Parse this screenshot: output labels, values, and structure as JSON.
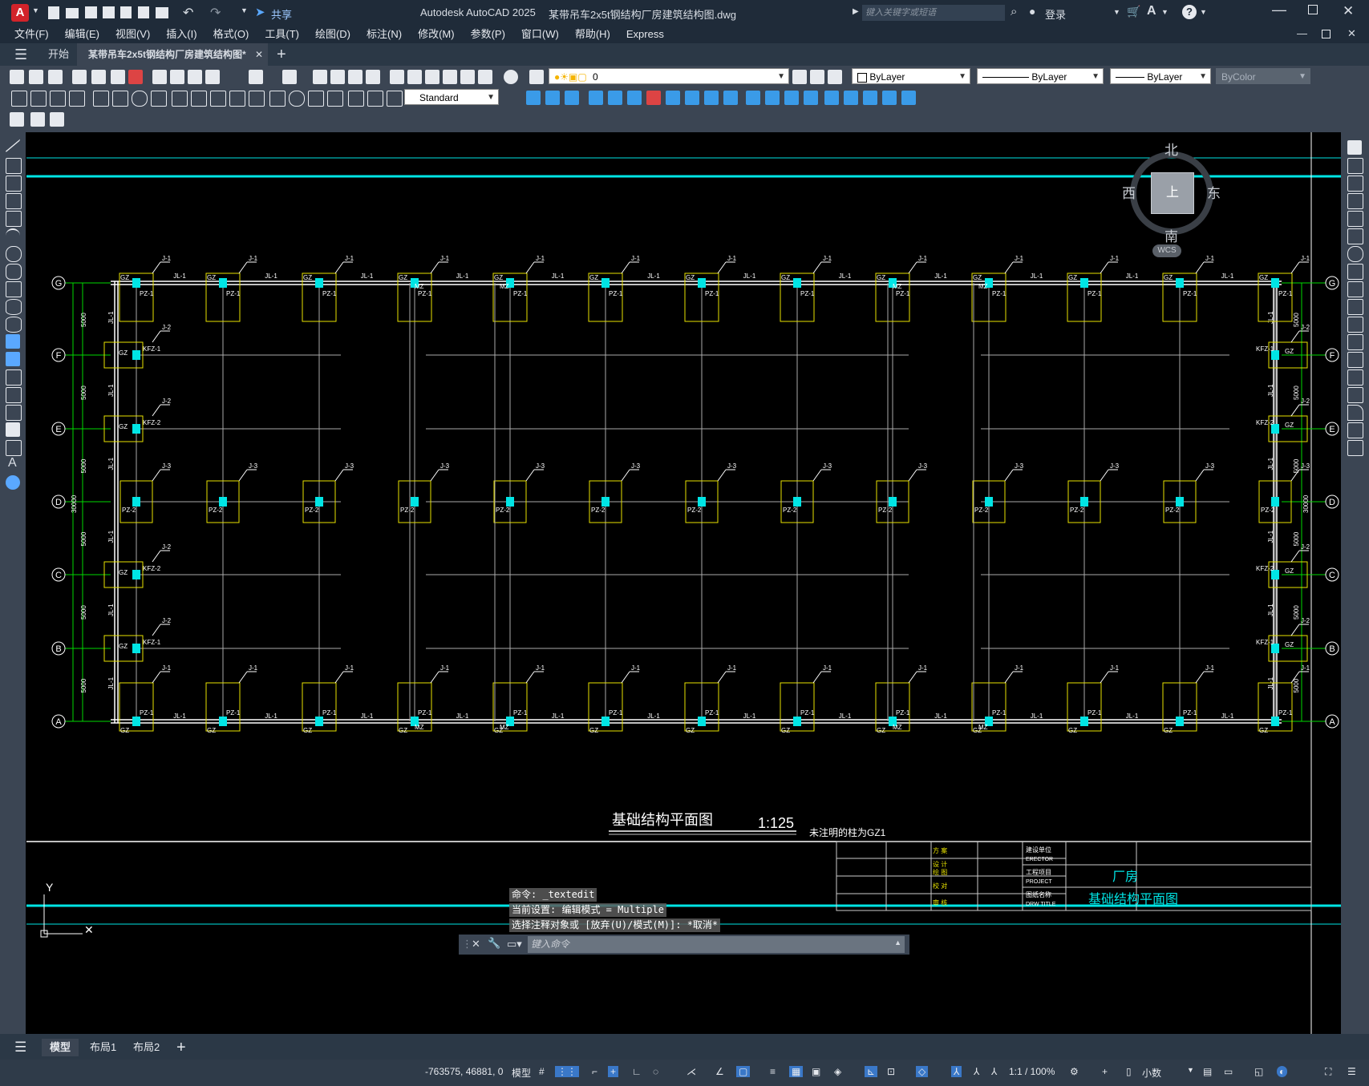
{
  "app": {
    "title": "Autodesk AutoCAD 2025",
    "filename": "某带吊车2x5t钢结构厂房建筑结构图.dwg",
    "search_placeholder": "键入关键字或短语",
    "login": "登录",
    "share": "共享"
  },
  "menu": [
    "文件(F)",
    "编辑(E)",
    "视图(V)",
    "插入(I)",
    "格式(O)",
    "工具(T)",
    "绘图(D)",
    "标注(N)",
    "修改(M)",
    "参数(P)",
    "窗口(W)",
    "帮助(H)",
    "Express"
  ],
  "tabs": {
    "start": "开始",
    "active": "某带吊车2x5t钢结构厂房建筑结构图*"
  },
  "toolbar": {
    "layer_value": "0",
    "color_value": "ByLayer",
    "linetype_value": "ByLayer",
    "lineweight_value": "ByLayer",
    "plotstyle_value": "ByColor",
    "dimstyle_value": "Standard"
  },
  "viewcube": {
    "north": "北",
    "south": "南",
    "east": "东",
    "west": "西",
    "top": "上",
    "wcs": "WCS"
  },
  "drawing": {
    "title": "基础结构平面图",
    "scale": "1:125",
    "note": "未注明的柱为GZ1",
    "axes_rows": [
      "G",
      "F",
      "E",
      "D",
      "C",
      "B",
      "A"
    ],
    "dim_5000": "5000",
    "dim_30000": "30000",
    "labels": {
      "J1": "J-1",
      "J2": "J-2",
      "J3": "J-3",
      "JL1": "JL-1",
      "GZ": "GZ",
      "MZ": "MZ",
      "PZ1": "PZ-1",
      "PZ2": "PZ-2",
      "KFZ1": "KFZ-1",
      "KFZ2": "KFZ-2"
    },
    "title_block": {
      "erector_cn": "建设单位",
      "erector_en": "ERECTOR",
      "project_cn": "工程项目",
      "project_en": "PROJECT",
      "drw_cn": "图纸名称",
      "drw_en": "DRW TITLE",
      "project_value": "厂房",
      "drw_value": "基础结构平面图",
      "fang_an": "方 案",
      "she_ji": "设 计",
      "hui_tu": "绘 图",
      "jiao_dui": "校 对",
      "shen_he": "审 核"
    },
    "ucs_y": "Y"
  },
  "command": {
    "line1": "命令: _textedit",
    "line2": "当前设置: 编辑模式 = Multiple",
    "line3": "选择注释对象或 [放弃(U)/模式(M)]: *取消*",
    "input_placeholder": "键入命令"
  },
  "layout_tabs": [
    "模型",
    "布局1",
    "布局2"
  ],
  "status": {
    "coords": "-763575, 46881, 0",
    "model": "模型",
    "scale": "1:1 / 100%",
    "units": "小数"
  },
  "colors": {
    "yellow": "#e8e200",
    "cyan": "#00e5e5",
    "green": "#00d800",
    "white": "#ffffff",
    "chrome_dark": "#1f2b39",
    "toolbar": "#3b4553"
  }
}
